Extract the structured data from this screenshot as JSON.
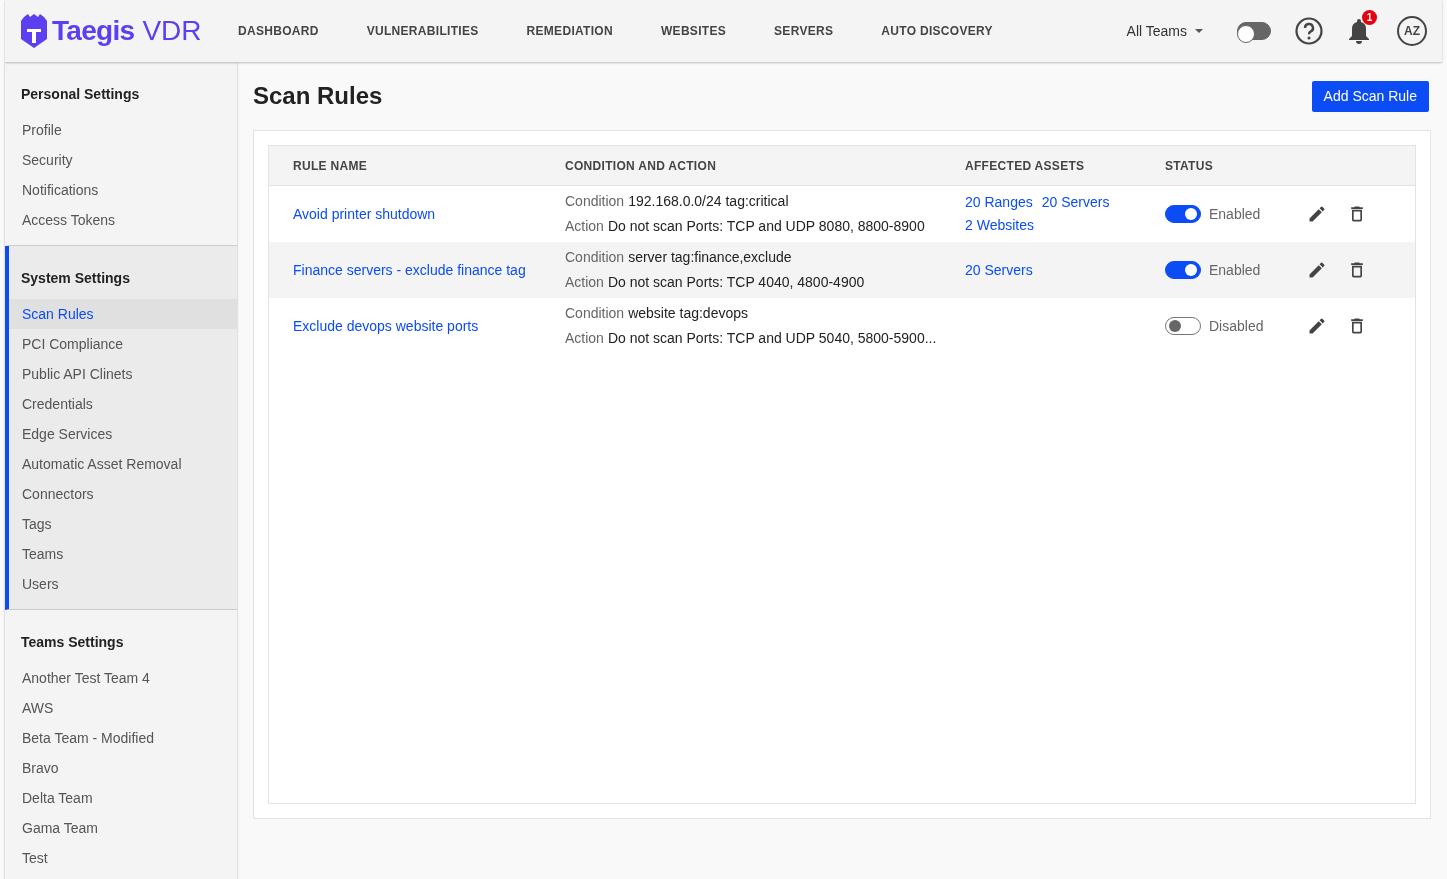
{
  "header": {
    "logo": {
      "brand": "Taegis",
      "product": "VDR"
    },
    "nav": [
      {
        "label": "DASHBOARD",
        "selected": false
      },
      {
        "label": "VULNERABILITIES",
        "selected": false
      },
      {
        "label": "REMEDIATION",
        "selected": false
      },
      {
        "label": "WEBSITES",
        "selected": false
      },
      {
        "label": "SERVERS",
        "selected": false
      },
      {
        "label": "AUTO DISCOVERY",
        "selected": false
      }
    ],
    "team_select": "All Teams",
    "toggle_on": false,
    "notification_count": "1",
    "avatar": "AZ"
  },
  "sidebar": [
    {
      "title": "Personal Settings",
      "active": false,
      "items": [
        {
          "label": "Profile",
          "selected": false
        },
        {
          "label": "Security",
          "selected": false
        },
        {
          "label": "Notifications",
          "selected": false
        },
        {
          "label": "Access Tokens",
          "selected": false
        }
      ]
    },
    {
      "title": "System Settings",
      "active": true,
      "items": [
        {
          "label": "Scan Rules",
          "selected": true
        },
        {
          "label": "PCI Compliance",
          "selected": false
        },
        {
          "label": "Public API Clinets",
          "selected": false
        },
        {
          "label": "Credentials",
          "selected": false
        },
        {
          "label": "Edge Services",
          "selected": false
        },
        {
          "label": "Automatic Asset Removal",
          "selected": false
        },
        {
          "label": "Connectors",
          "selected": false
        },
        {
          "label": "Tags",
          "selected": false
        },
        {
          "label": "Teams",
          "selected": false
        },
        {
          "label": "Users",
          "selected": false
        }
      ]
    },
    {
      "title": "Teams Settings",
      "active": false,
      "items": [
        {
          "label": "Another Test Team 4",
          "selected": false
        },
        {
          "label": "AWS",
          "selected": false
        },
        {
          "label": "Beta Team - Modified",
          "selected": false
        },
        {
          "label": "Bravo",
          "selected": false
        },
        {
          "label": "Delta Team",
          "selected": false
        },
        {
          "label": "Gama Team",
          "selected": false
        },
        {
          "label": "Test",
          "selected": false
        }
      ]
    }
  ],
  "page": {
    "title": "Scan Rules",
    "add_button": "Add Scan Rule"
  },
  "table": {
    "columns": [
      "RULE NAME",
      "CONDITION AND ACTION",
      "AFFECTED ASSETS",
      "STATUS"
    ],
    "rows": [
      {
        "name": "Avoid printer shutdown",
        "condition_label": "Condition",
        "condition": "192.168.0.0/24 tag:critical",
        "action_label": "Action",
        "action": "Do not scan Ports: TCP and UDP 8080, 8800-8900",
        "assets": [
          "20 Ranges",
          "20 Servers",
          "2 Websites"
        ],
        "enabled": true,
        "status": "Enabled"
      },
      {
        "name": "Finance servers - exclude finance tag",
        "condition_label": "Condition",
        "condition": "server tag:finance,exclude",
        "action_label": "Action",
        "action": "Do not scan Ports: TCP 4040, 4800-4900",
        "assets": [
          "20 Servers"
        ],
        "enabled": true,
        "status": "Enabled"
      },
      {
        "name": "Exclude devops website ports",
        "condition_label": "Condition",
        "condition": "website tag:devops",
        "action_label": "Action",
        "action": "Do not scan Ports: TCP and UDP 5040, 5800-5900...",
        "assets": [],
        "enabled": false,
        "status": "Disabled"
      }
    ]
  }
}
